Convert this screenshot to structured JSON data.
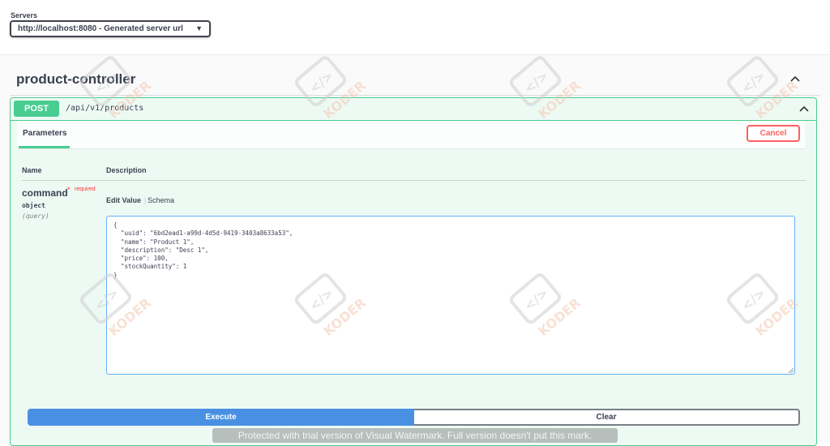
{
  "servers": {
    "label": "Servers",
    "selected": "http://localhost:8080 - Generated server url"
  },
  "tag": {
    "title": "product-controller"
  },
  "operation": {
    "method": "POST",
    "path": "/api/v1/products",
    "method_color": "#49cc90",
    "tabs": {
      "parameters": "Parameters"
    },
    "cancel_label": "Cancel",
    "table": {
      "name_header": "Name",
      "description_header": "Description"
    },
    "param": {
      "name": "command",
      "required_star": "*",
      "required_label": "required",
      "type": "object",
      "in": "(query)",
      "edit_value_tab": "Edit Value",
      "separator": "|",
      "schema_tab": "Schema",
      "value": "{\n  \"uuid\": \"6bd2ead1-a99d-4d5d-9419-3403a8633a53\",\n  \"name\": \"Product 1\",\n  \"description\": \"Desc 1\",\n  \"price\": 100,\n  \"stockQuantity\": 1\n}"
    },
    "execute_label": "Execute",
    "clear_label": "Clear"
  },
  "watermark": {
    "mark": "</>",
    "brand": "KODER",
    "banner": "Protected with trial version of Visual Watermark. Full version doesn't put this mark."
  },
  "colors": {
    "accent_blue": "#4990e2",
    "cancel_red": "#ff6060",
    "post_green": "#49cc90"
  }
}
